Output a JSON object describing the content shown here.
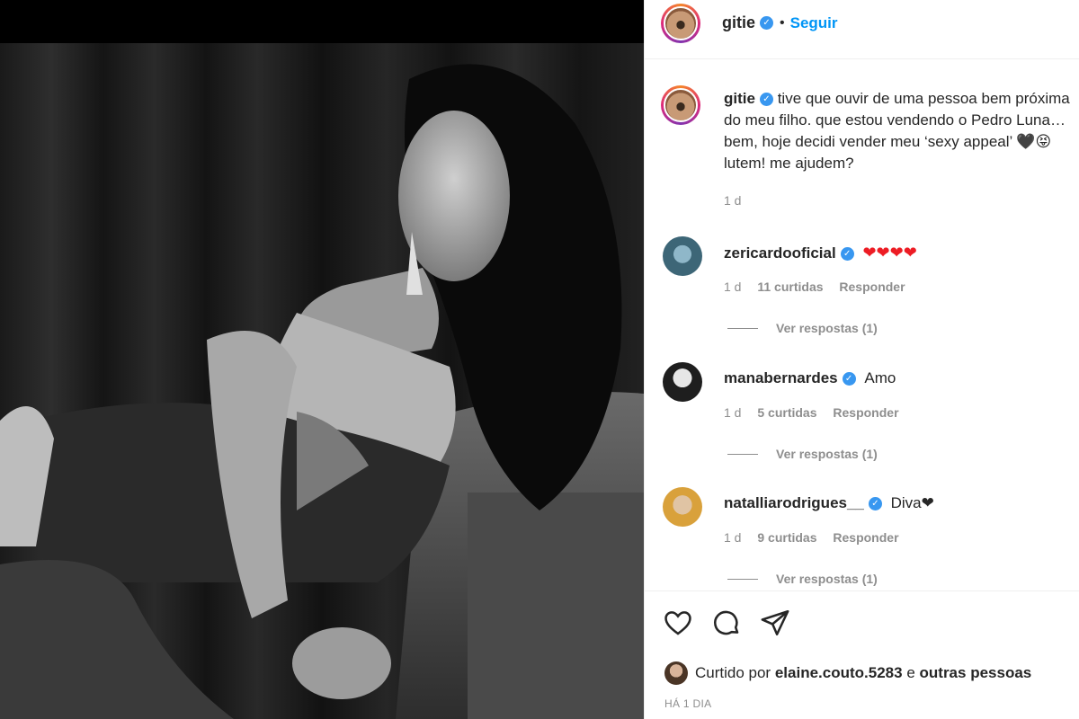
{
  "post": {
    "username": "gitie",
    "follow_label": "Seguir",
    "separator": "•"
  },
  "caption": {
    "username": "gitie",
    "text": "tive que ouvir de uma pessoa bem próxima do meu filho. que estou vendendo o Pedro Luna… bem, hoje decidi vender meu ‘sexy appeal’ 🖤😝 lutem! me ajudem?",
    "time": "1 d"
  },
  "comments": [
    {
      "username": "zericardooficial",
      "text": "❤❤❤❤",
      "time": "1 d",
      "likes": "11 curtidas",
      "reply": "Responder",
      "replies": "Ver respostas (1)"
    },
    {
      "username": "manabernardes",
      "text": "Amo",
      "time": "1 d",
      "likes": "5 curtidas",
      "reply": "Responder",
      "replies": "Ver respostas (1)"
    },
    {
      "username": "natalliarodrigues__",
      "text": "Diva❤",
      "time": "1 d",
      "likes": "9 curtidas",
      "reply": "Responder",
      "replies": "Ver respostas (1)"
    }
  ],
  "actions": {
    "liked_prefix": "Curtido por",
    "liked_user": "elaine.couto.5283",
    "liked_join": "e",
    "liked_others": "outras pessoas",
    "posted_time": "HÁ 1 DIA"
  },
  "icons": [
    "verified-icon",
    "heart-icon",
    "comment-icon",
    "share-icon"
  ],
  "colors": {
    "link": "#0095f6",
    "verified": "#3897f0",
    "muted": "#8e8e8e",
    "heart": "#ed1c24"
  }
}
